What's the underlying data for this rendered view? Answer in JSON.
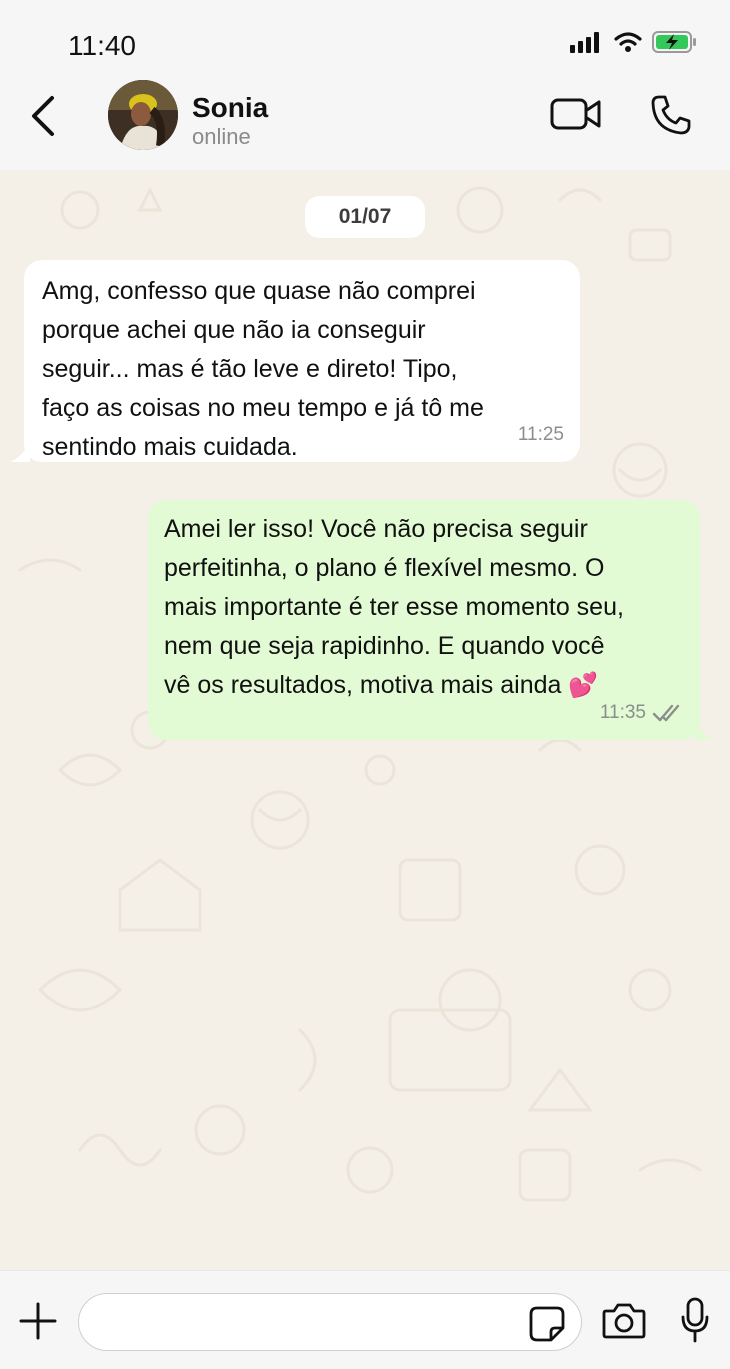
{
  "status_bar": {
    "time": "11:40"
  },
  "header": {
    "contact_name": "Sonia",
    "contact_status": "online"
  },
  "chat": {
    "date_chip": "01/07",
    "messages": [
      {
        "direction": "incoming",
        "text": "Amg, confesso que quase não comprei\nporque achei que não ia conseguir\nseguir... mas é tão leve e direto! Tipo,\nfaço as coisas no meu tempo e já tô me\nsentindo mais cuidada.",
        "time": "11:25"
      },
      {
        "direction": "outgoing",
        "text": "Amei ler isso! Você não precisa seguir\nperfeitinha, o plano é flexível mesmo. O\nmais importante é ter esse momento seu,\nnem que seja rapidinho. E quando você\nvê os resultados, motiva mais ainda ",
        "emoji": "💕",
        "time": "11:35",
        "status": "read"
      }
    ]
  },
  "input_bar": {
    "placeholder": ""
  },
  "icons": {
    "back": "chevron-left-icon",
    "video": "video-camera-icon",
    "call": "phone-icon",
    "plus": "plus-icon",
    "sticker": "sticker-icon",
    "camera": "camera-icon",
    "mic": "microphone-icon"
  },
  "colors": {
    "incoming_bubble": "#ffffff",
    "outgoing_bubble": "#e2fbd4",
    "chat_background": "#f4efe7",
    "read_ticks": "#8a8f8a"
  }
}
